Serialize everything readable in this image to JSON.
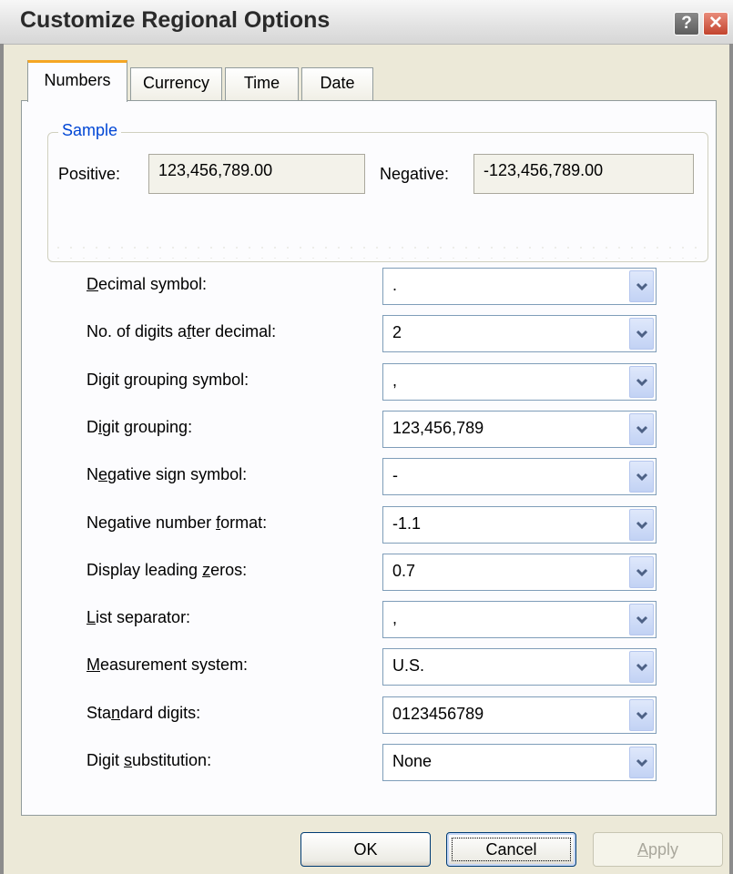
{
  "window": {
    "title": "Customize Regional Options",
    "help_glyph": "?",
    "close_glyph": "✕"
  },
  "tabs": [
    {
      "label": "Numbers",
      "active": true
    },
    {
      "label": "Currency",
      "active": false
    },
    {
      "label": "Time",
      "active": false
    },
    {
      "label": "Date",
      "active": false
    }
  ],
  "sample": {
    "group_label": "Sample",
    "positive_label": "Positive:",
    "positive_value": "123,456,789.00",
    "negative_label": "Negative:",
    "negative_value": "-123,456,789.00"
  },
  "options": [
    {
      "pre": "",
      "u": "D",
      "post": "ecimal symbol:",
      "value": "."
    },
    {
      "pre": "No. of digits a",
      "u": "f",
      "post": "ter decimal:",
      "value": "2"
    },
    {
      "pre": "Digit grouping symbol:",
      "u": "",
      "post": "",
      "value": ","
    },
    {
      "pre": "D",
      "u": "i",
      "post": "git grouping:",
      "value": "123,456,789"
    },
    {
      "pre": "N",
      "u": "e",
      "post": "gative sign symbol:",
      "value": "-"
    },
    {
      "pre": "Negative number ",
      "u": "f",
      "post": "ormat:",
      "value": "-1.1"
    },
    {
      "pre": "Display leading ",
      "u": "z",
      "post": "eros:",
      "value": "0.7"
    },
    {
      "pre": "",
      "u": "L",
      "post": "ist separator:",
      "value": ","
    },
    {
      "pre": "",
      "u": "M",
      "post": "easurement system:",
      "value": "U.S."
    },
    {
      "pre": "Sta",
      "u": "n",
      "post": "dard digits:",
      "value": "0123456789"
    },
    {
      "pre": "Digit ",
      "u": "s",
      "post": "ubstitution:",
      "value": "None"
    }
  ],
  "buttons": {
    "ok": "OK",
    "cancel": "Cancel",
    "apply_u": "A",
    "apply_rest": "pply"
  },
  "colors": {
    "accent_tab": "#f5a623",
    "group_label": "#0046d5",
    "dialog_bg": "#ece9d8",
    "panel_bg": "#fcfcfe",
    "close_button": "#c2442e"
  }
}
